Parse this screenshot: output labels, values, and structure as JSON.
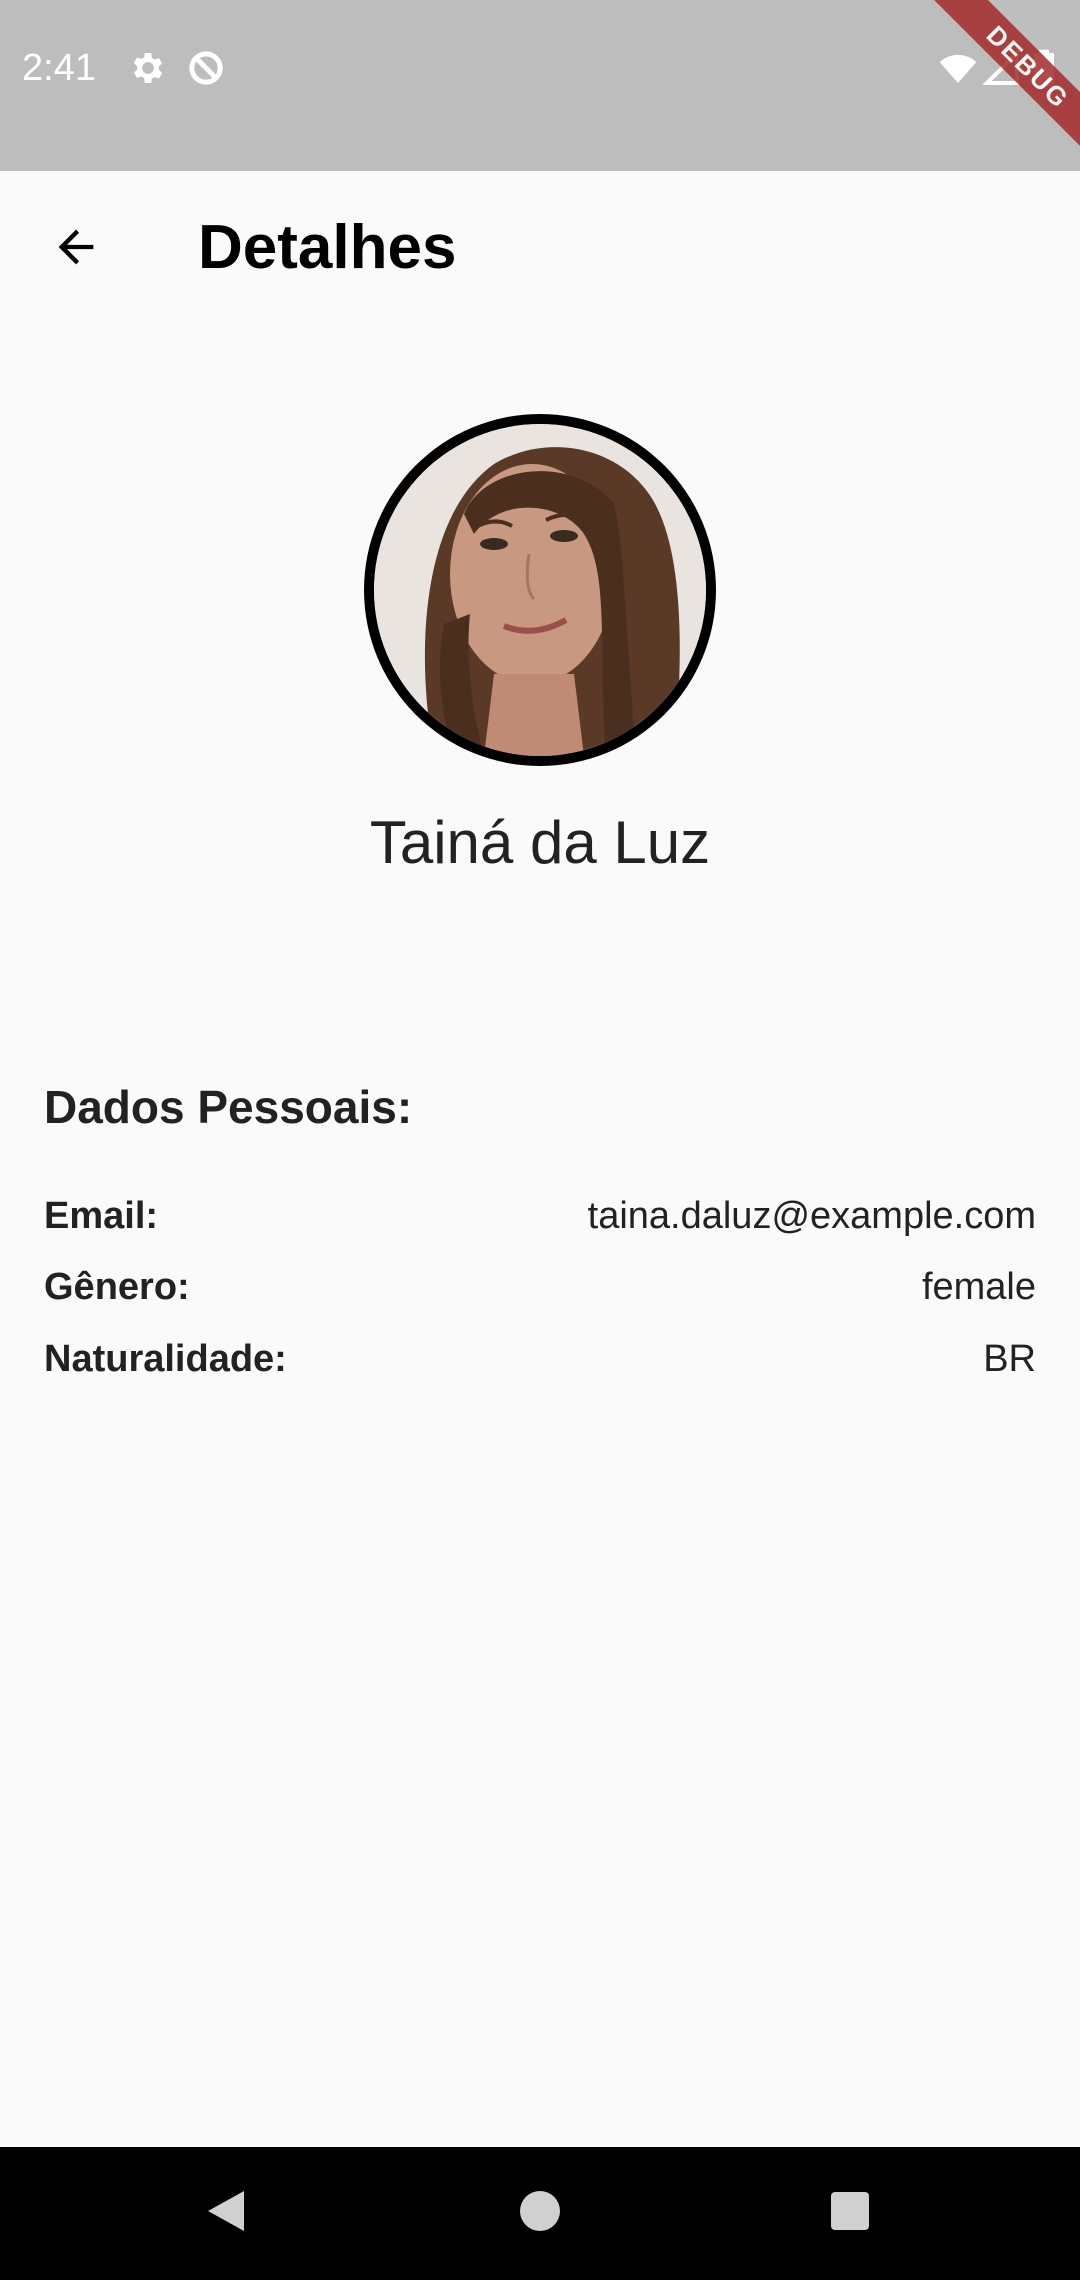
{
  "status_bar": {
    "time": "2:41",
    "debug_label": "DEBUG",
    "icons": [
      "gear-icon",
      "data-saver-icon",
      "wifi-icon",
      "signal-icon",
      "battery-icon"
    ]
  },
  "app_bar": {
    "title": "Detalhes",
    "back_icon": "arrow-back-icon"
  },
  "profile": {
    "name": "Tainá da Luz",
    "avatar_border_color": "#000000"
  },
  "personal_data": {
    "section_title": "Dados Pessoais:",
    "rows": [
      {
        "label": "Email:",
        "value": "taina.daluz@example.com"
      },
      {
        "label": "Gênero:",
        "value": "female"
      },
      {
        "label": "Naturalidade:",
        "value": "BR"
      }
    ]
  },
  "nav_bar": {
    "buttons": [
      "back-triangle-icon",
      "home-circle-icon",
      "recents-square-icon"
    ]
  },
  "colors": {
    "status_bar": "#bdbdbd",
    "background": "#fafafa",
    "text": "#222222",
    "nav_bar": "#000000",
    "debug_ribbon": "#a52a2a"
  }
}
